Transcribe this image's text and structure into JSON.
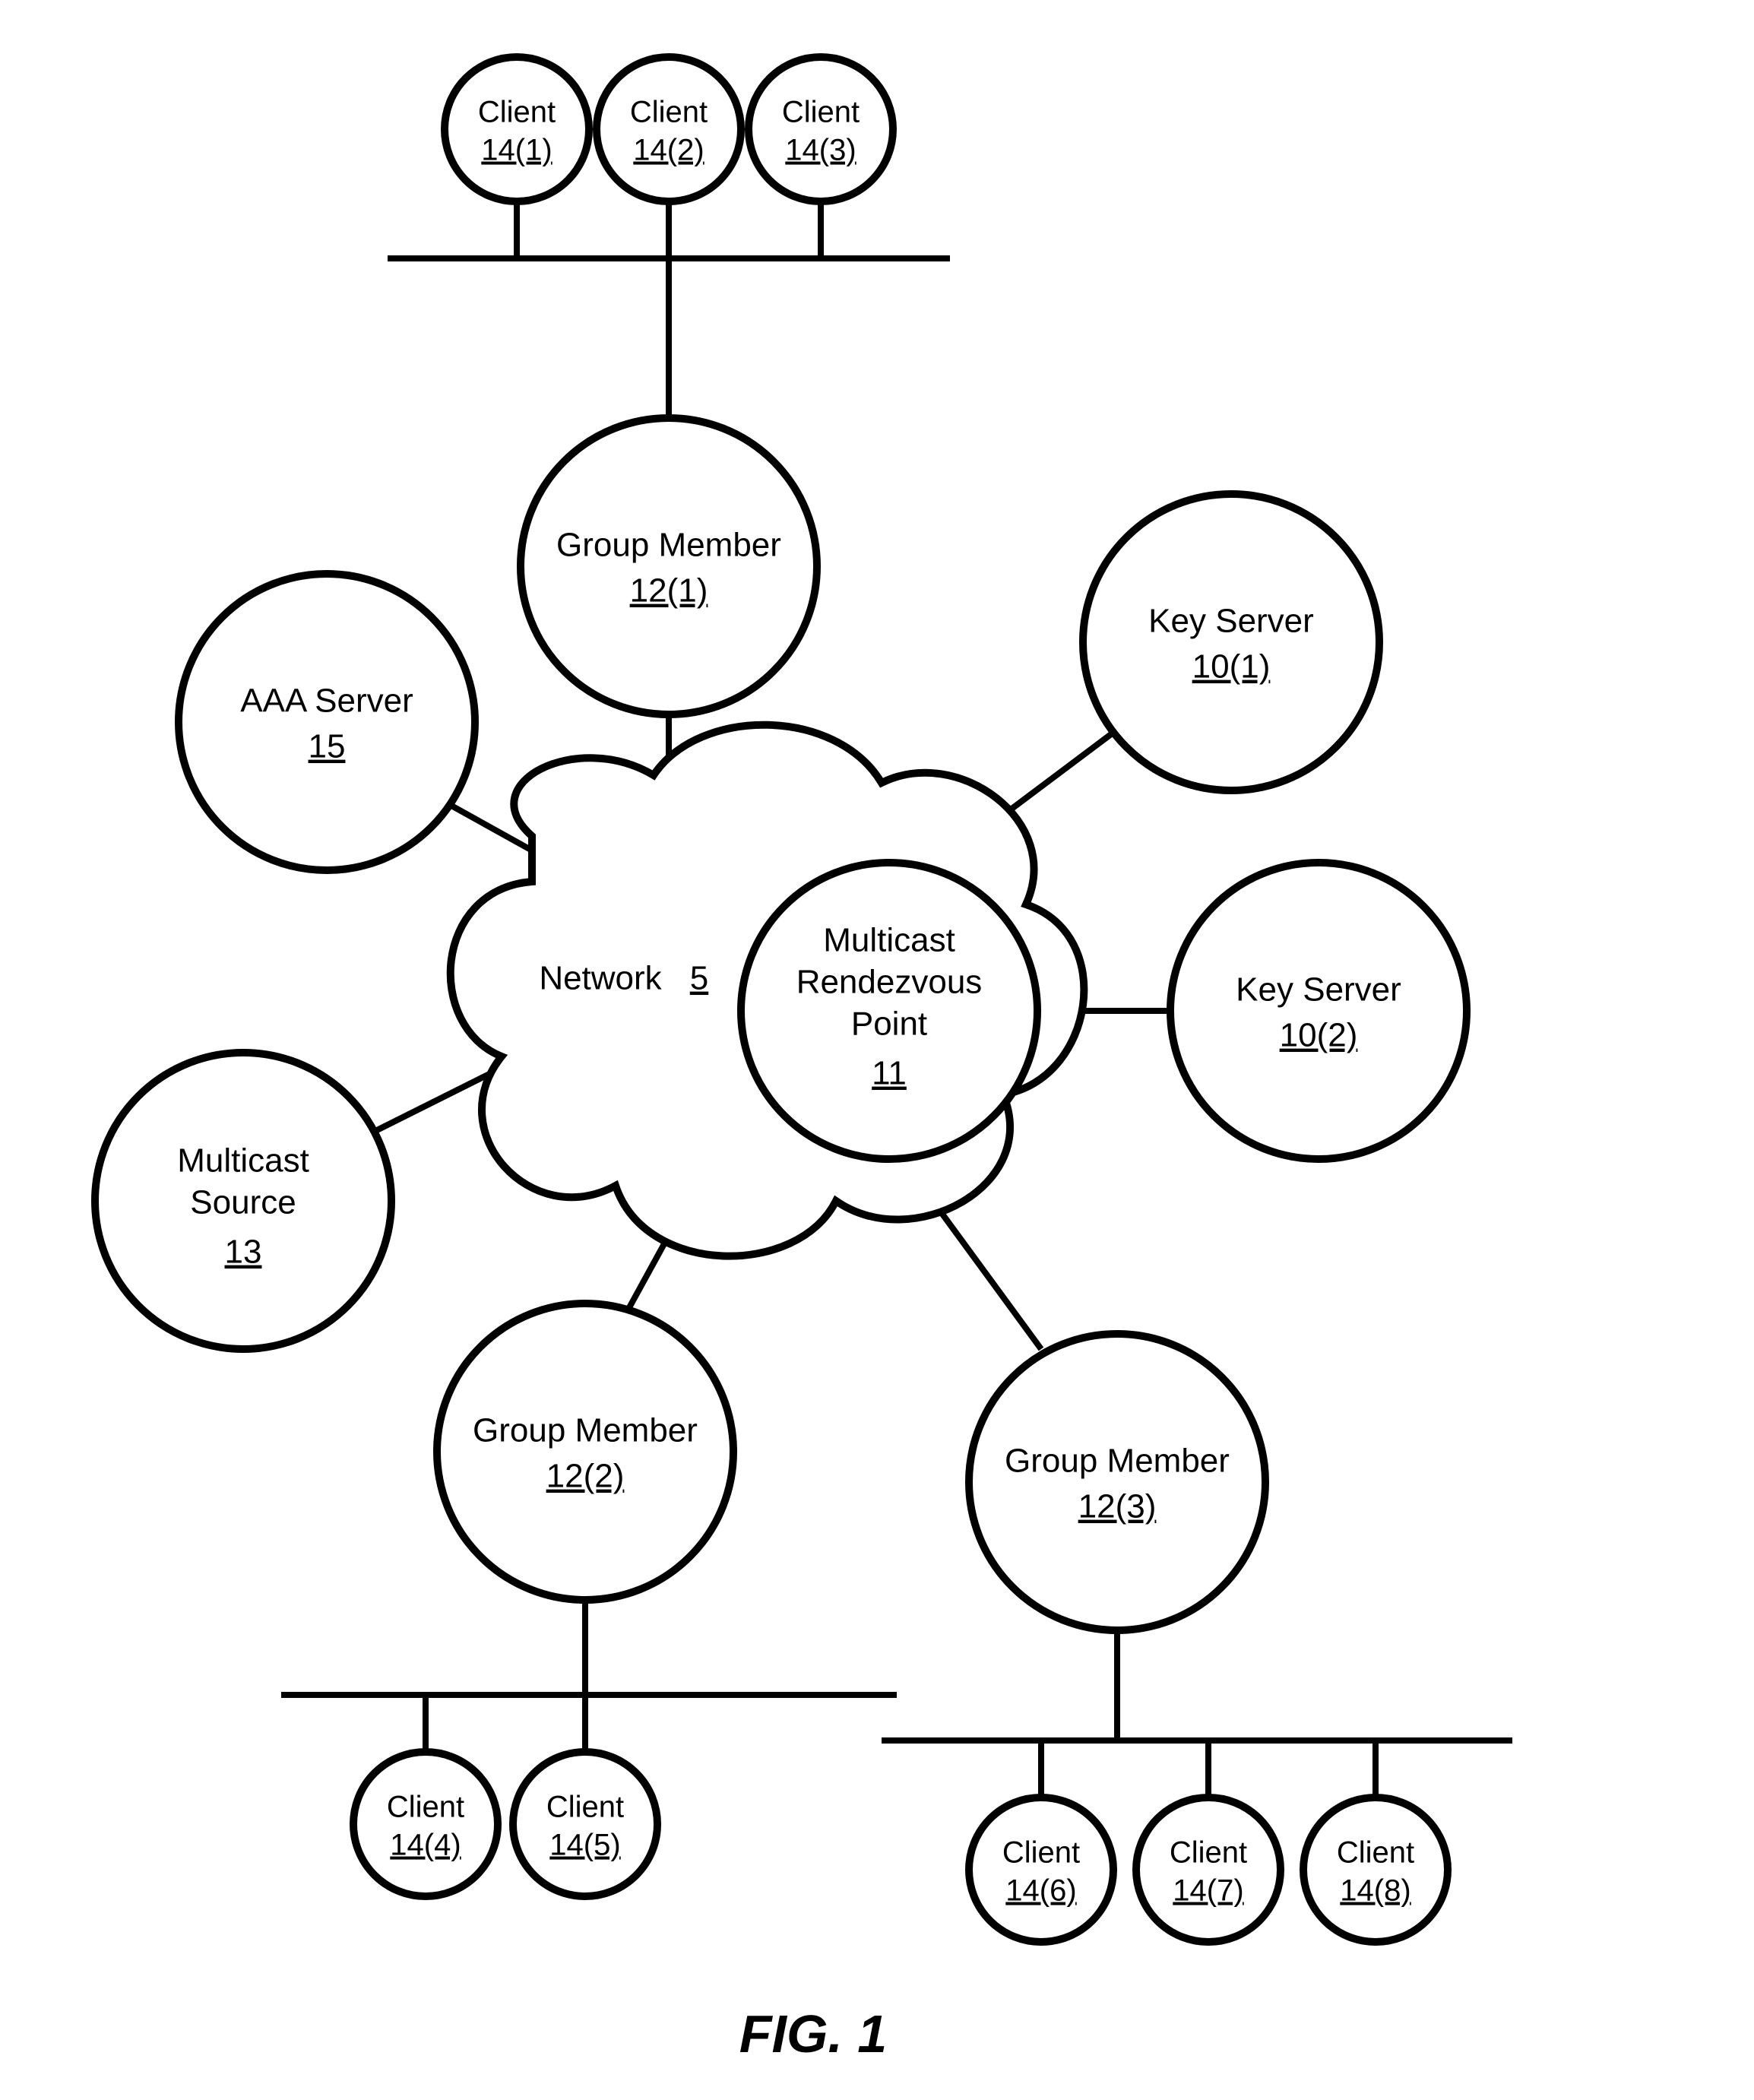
{
  "figure_label": "FIG. 1",
  "network": {
    "label": "Network",
    "ref": "5"
  },
  "rendezvous": {
    "line1": "Multicast",
    "line2": "Rendezvous",
    "line3": "Point",
    "ref": "11"
  },
  "nodes": {
    "aaa": {
      "line1": "AAA Server",
      "ref": "15"
    },
    "multicast_source": {
      "line1": "Multicast",
      "line2": "Source",
      "ref": "13"
    },
    "key_server_1": {
      "line1": "Key Server",
      "ref": "10(1)"
    },
    "key_server_2": {
      "line1": "Key Server",
      "ref": "10(2)"
    },
    "group_member_1": {
      "line1": "Group Member",
      "ref": "12(1)"
    },
    "group_member_2": {
      "line1": "Group Member",
      "ref": "12(2)"
    },
    "group_member_3": {
      "line1": "Group Member",
      "ref": "12(3)"
    }
  },
  "clients": {
    "c1": {
      "label": "Client",
      "ref": "14(1)"
    },
    "c2": {
      "label": "Client",
      "ref": "14(2)"
    },
    "c3": {
      "label": "Client",
      "ref": "14(3)"
    },
    "c4": {
      "label": "Client",
      "ref": "14(4)"
    },
    "c5": {
      "label": "Client",
      "ref": "14(5)"
    },
    "c6": {
      "label": "Client",
      "ref": "14(6)"
    },
    "c7": {
      "label": "Client",
      "ref": "14(7)"
    },
    "c8": {
      "label": "Client",
      "ref": "14(8)"
    }
  }
}
